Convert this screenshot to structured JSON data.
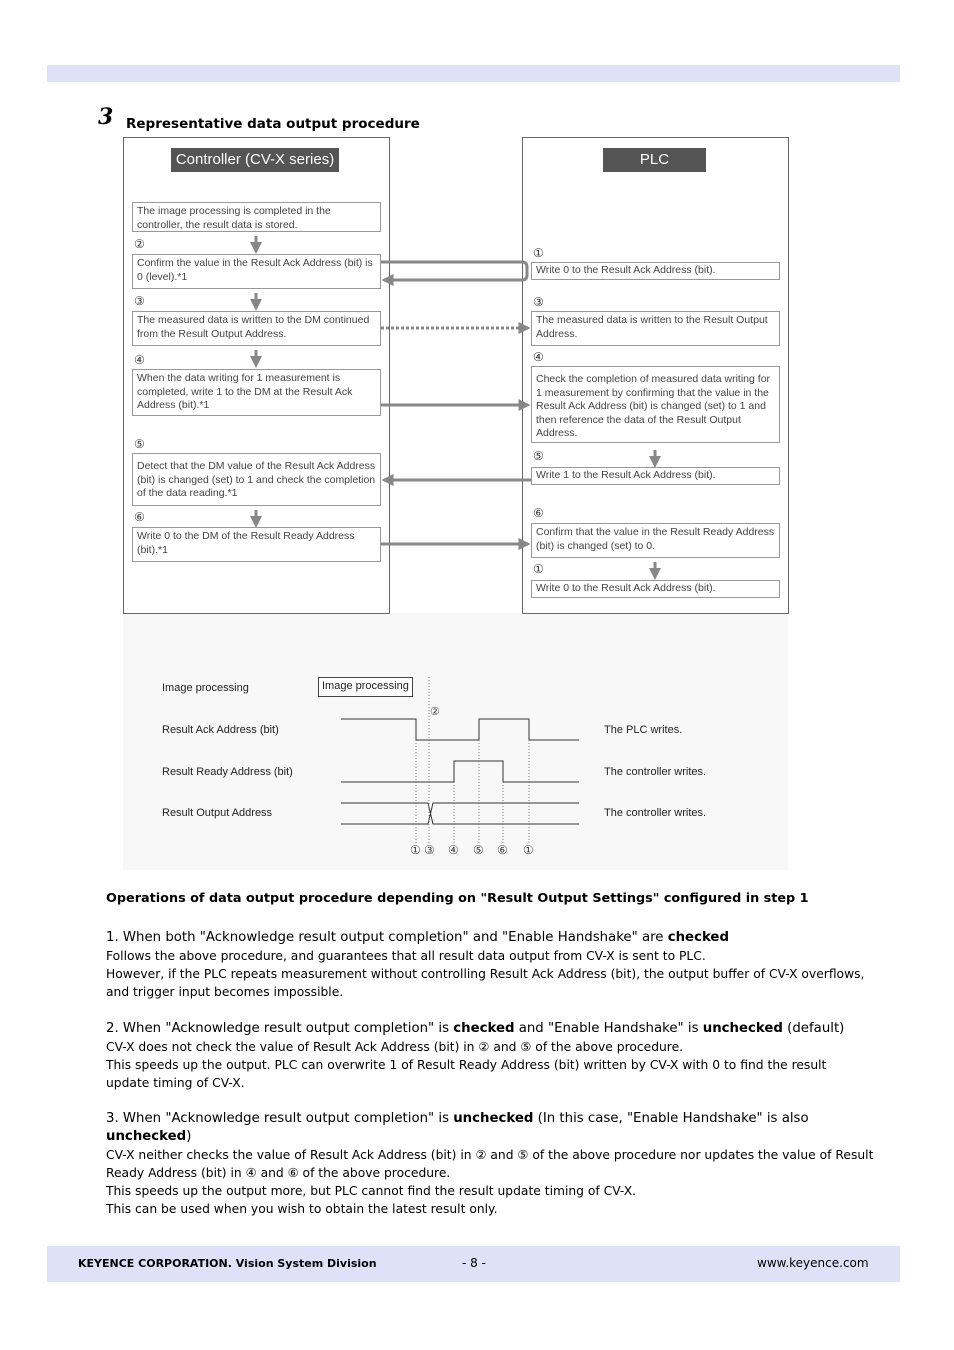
{
  "section": {
    "number": "3",
    "title": "Representative data output procedure"
  },
  "controller": {
    "header": "Controller (CV-X series)",
    "steps": [
      {
        "num": "",
        "text": "The image processing is completed in the controller, the result data is stored."
      },
      {
        "num": "②",
        "text": "Confirm the value in the Result Ack Address (bit) is 0 (level).*1"
      },
      {
        "num": "③",
        "text": "The measured data is written to the DM continued from the Result Output Address."
      },
      {
        "num": "④",
        "text": "When the data writing for 1 measurement is completed, write 1 to the DM at the Result Ack Address (bit).*1"
      },
      {
        "num": "⑤",
        "text": "Detect that the DM value of the Result Ack Address (bit) is changed (set) to 1 and check the completion of the data reading.*1"
      },
      {
        "num": "⑥",
        "text": "Write 0 to the DM of the Result Ready Address (bit).*1"
      }
    ]
  },
  "plc": {
    "header": "PLC",
    "steps": [
      {
        "num": "①",
        "text": "Write 0 to the Result Ack Address (bit)."
      },
      {
        "num": "③",
        "text": "The measured data is written to the Result Output Address."
      },
      {
        "num": "④",
        "text": "Check the completion of measured data writing for 1 measurement by confirming that the value in the Result Ack Address (bit) is changed (set) to 1 and then reference the data of the Result Output Address."
      },
      {
        "num": "⑤",
        "text": "Write 1 to the Result Ack Address (bit)."
      },
      {
        "num": "⑥",
        "text": "Confirm that the value in the Result Ready Address (bit) is changed (set) to 0."
      },
      {
        "num": "①",
        "text": "Write 0 to the Result Ack Address (bit)."
      }
    ]
  },
  "timing": {
    "rows": [
      {
        "label": "Image processing",
        "note": ""
      },
      {
        "label": "Result Ack Address (bit)",
        "note": "The PLC writes."
      },
      {
        "label": "Result Ready Address (bit)",
        "note": "The controller writes."
      },
      {
        "label": "Result Output Address",
        "note": "The controller writes."
      }
    ],
    "box": "Image processing",
    "marker_top": "②",
    "markers": [
      "①",
      "③",
      "④",
      "⑤",
      "⑥",
      "①"
    ]
  },
  "ops": {
    "heading": "Operations of data output procedure depending on \"Result Output Settings\" configured in step 1",
    "p1": {
      "a": "1. When both \"Acknowledge result output completion\" and \"Enable Handshake\" are ",
      "b": "checked",
      "body": "Follows the above procedure, and guarantees that all result data output from CV-X is sent to PLC.\nHowever, if the PLC repeats measurement without controlling Result Ack Address (bit), the output buffer of CV-X overflows, and trigger input becomes impossible."
    },
    "p2": {
      "a": "2. When \"Acknowledge result output completion\" is ",
      "b": "checked",
      "c": " and \"Enable Handshake\" is ",
      "d": "unchecked",
      "e": " (default)",
      "body": "CV-X does not check the value of Result Ack Address (bit) in ② and ⑤ of the above procedure.\nThis speeds up the output. PLC can overwrite 1 of Result Ready  Address (bit) written by CV-X with 0 to find the result update timing of CV-X."
    },
    "p3": {
      "a": "3. When \"Acknowledge result output completion\" is ",
      "b": "unchecked",
      "c": " (In this case, \"Enable Handshake\" is also ",
      "d": "unchecked",
      "e": ")",
      "body": "CV-X neither checks the value of Result Ack Address (bit) in ② and ⑤ of the above procedure nor updates the value of Result Ready Address (bit) in ④ and ⑥ of the above procedure.\n This speeds up the output more, but PLC cannot find the result update timing of CV-X.\n This can be used when you wish to obtain the latest result only."
    }
  },
  "footer": {
    "company": "KEYENCE CORPORATION. Vision System Division",
    "page": "- 8 -",
    "url": "www.keyence.com"
  },
  "colors": {
    "band": "#dfe1f8",
    "header_box": "#555555",
    "arrow": "#888888"
  }
}
